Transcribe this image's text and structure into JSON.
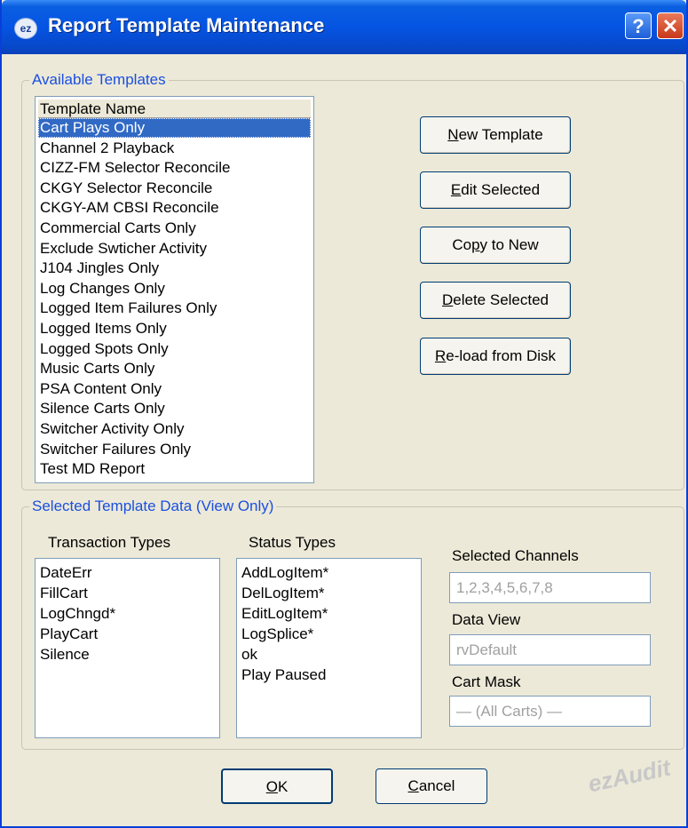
{
  "window": {
    "title": "Report Template Maintenance",
    "app_icon_text": "ez",
    "help_label": "?",
    "close_label": "✕"
  },
  "available": {
    "legend": "Available Templates",
    "column_header": "Template Name",
    "selected_index": 0,
    "items": [
      "Cart Plays Only",
      "Channel 2 Playback",
      "CIZZ-FM Selector Reconcile",
      "CKGY Selector Reconcile",
      "CKGY-AM CBSI Reconcile",
      "Commercial Carts Only",
      "Exclude Swticher Activity",
      "J104 Jingles Only",
      "Log Changes Only",
      "Logged Item Failures Only",
      "Logged Items Only",
      "Logged Spots Only",
      "Music Carts Only",
      "PSA Content Only",
      "Silence Carts Only",
      "Switcher Activity Only",
      "Switcher Failures Only",
      "Test MD Report"
    ]
  },
  "actions": {
    "new_template": {
      "pre": "",
      "key": "N",
      "post": "ew Template"
    },
    "edit_selected": {
      "pre": "",
      "key": "E",
      "post": "dit Selected"
    },
    "copy_to_new": {
      "pre": "Co",
      "key": "p",
      "post": "y to New"
    },
    "delete_selected": {
      "pre": "",
      "key": "D",
      "post": "elete Selected"
    },
    "reload": {
      "pre": "",
      "key": "R",
      "post": "e-load from Disk"
    }
  },
  "selected": {
    "legend": "Selected Template Data (View Only)",
    "transaction_label": "Transaction Types",
    "transaction_types": [
      "DateErr",
      "FillCart",
      "LogChngd*",
      "PlayCart",
      "Silence"
    ],
    "status_label": "Status Types",
    "status_types": [
      "AddLogItem*",
      "DelLogItem*",
      "EditLogItem*",
      "LogSplice*",
      "ok",
      "Play Paused"
    ],
    "channels_label": "Selected Channels",
    "channels_value": "1,2,3,4,5,6,7,8",
    "data_view_label": "Data View",
    "data_view_value": "rvDefault",
    "cart_mask_label": "Cart Mask",
    "cart_mask_value": "— (All Carts) —"
  },
  "footer": {
    "ok": {
      "pre": "",
      "key": "O",
      "post": "K"
    },
    "cancel": {
      "pre": "",
      "key": "C",
      "post": "ancel"
    },
    "watermark": "ezAudit"
  },
  "colors": {
    "title_blue": "#0554e3",
    "legend_blue": "#1a4fe0",
    "selection": "#316ac5",
    "dialog_bg": "#ece9d8"
  }
}
